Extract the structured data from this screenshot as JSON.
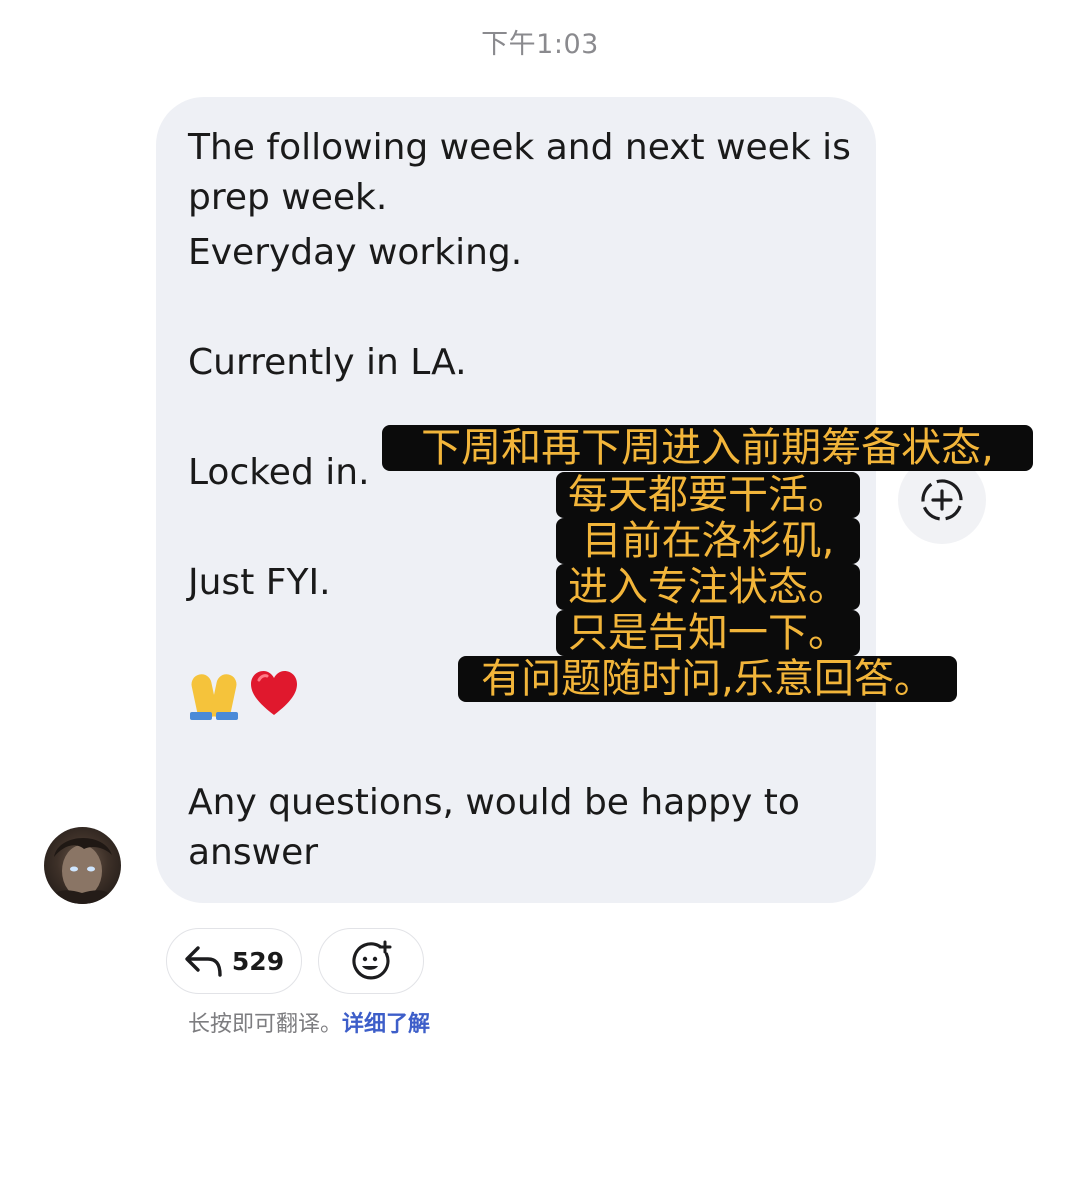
{
  "timestamp": "下午1:03",
  "message": {
    "lines": [
      "The following week and next week is",
      "prep week.",
      "Everyday working.",
      "Currently in LA.",
      "Locked in.",
      "Just FYI.",
      "Any questions, would be happy to",
      "answer"
    ],
    "emojis": [
      "folded-hands",
      "red-heart"
    ]
  },
  "subtitles": [
    "下周和再下周进入前期筹备状态,",
    "每天都要干活。",
    "目前在洛杉矶,",
    "进入专注状态。",
    "只是告知一下。",
    "有问题随时问,乐意回答。"
  ],
  "reactions": {
    "reply_count": "529",
    "reply_icon": "reply-arrow-icon",
    "add_reaction_icon": "add-emoji-icon",
    "message_action_icon": "circle-plus-icon"
  },
  "footer": {
    "note": "长按即可翻译。",
    "link": "详细了解"
  },
  "colors": {
    "bubble_bg": "#eef0f5",
    "subtitle_text": "#f2b53a",
    "subtitle_bg": "#0b0b0b",
    "link": "#3d5ec9"
  }
}
